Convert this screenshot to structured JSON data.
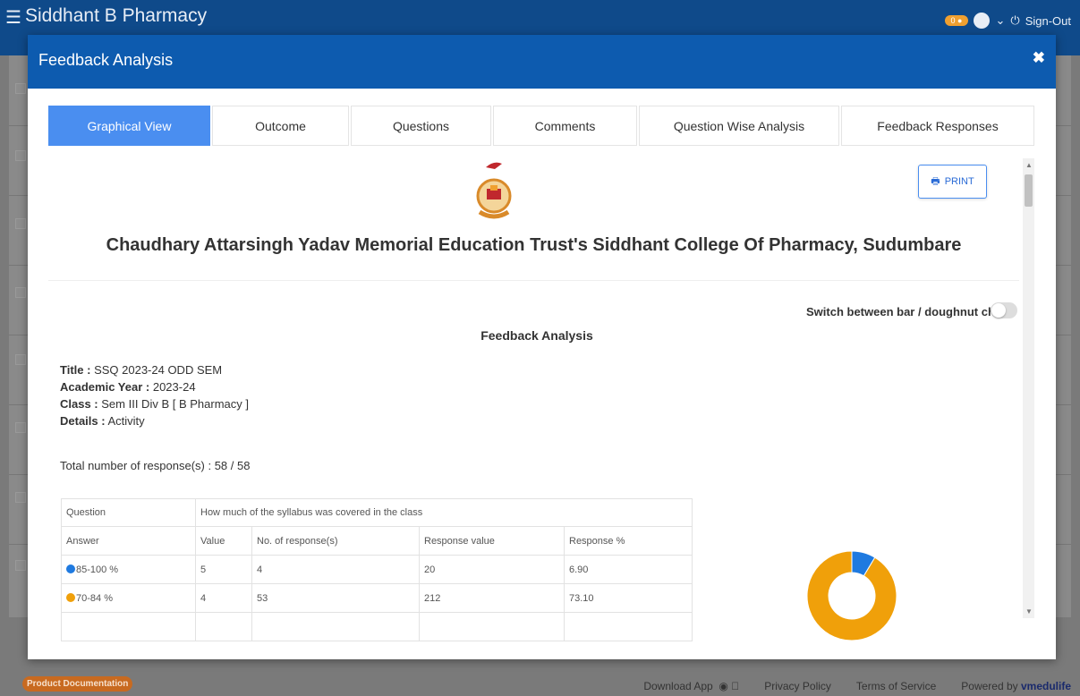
{
  "app": {
    "title": "Siddhant B Pharmacy",
    "badge_count": "0",
    "signout_label": "Sign-Out"
  },
  "footer": {
    "product_doc": "Product Documentation",
    "download_app": "Download App",
    "privacy": "Privacy Policy",
    "terms": "Terms of Service",
    "powered_by": "Powered by",
    "brand": "vmedulife"
  },
  "modal": {
    "title": "Feedback Analysis"
  },
  "tabs": [
    {
      "label": "Graphical View",
      "active": true
    },
    {
      "label": "Outcome",
      "active": false
    },
    {
      "label": "Questions",
      "active": false
    },
    {
      "label": "Comments",
      "active": false
    },
    {
      "label": "Question Wise Analysis",
      "active": false
    },
    {
      "label": "Feedback Responses",
      "active": false
    }
  ],
  "report": {
    "print_label": "PRINT",
    "college_name": "Chaudhary Attarsingh Yadav Memorial Education Trust's Siddhant College Of Pharmacy, Sudumbare",
    "switch_label": "Switch between bar / doughnut chart",
    "section_title": "Feedback Analysis",
    "meta": {
      "title_label": "Title :",
      "title_value": "SSQ 2023-24 ODD SEM",
      "year_label": "Academic Year :",
      "year_value": "2023-24",
      "class_label": "Class :",
      "class_value": "Sem III Div B [ B Pharmacy ]",
      "details_label": "Details :",
      "details_value": "Activity"
    },
    "total_label": "Total number of response(s) : 58 / 58"
  },
  "table": {
    "question_label": "Question",
    "question_text": "How much of the syllabus was covered in the class",
    "headers": [
      "Answer",
      "Value",
      "No. of response(s)",
      "Response value",
      "Response %"
    ],
    "rows": [
      {
        "answer": "85-100 %",
        "value": "5",
        "responses": "4",
        "response_value": "20",
        "percent": "6.90",
        "color": "#1f7ae0"
      },
      {
        "answer": "70-84 %",
        "value": "4",
        "responses": "53",
        "response_value": "212",
        "percent": "73.10",
        "color": "#f0a00a"
      }
    ]
  },
  "chart_data": {
    "type": "pie",
    "variant": "doughnut",
    "categories": [
      "85-100 %",
      "70-84 %"
    ],
    "values": [
      6.9,
      73.1
    ],
    "colors": [
      "#1f7ae0",
      "#f0a00a"
    ],
    "legend": "none"
  }
}
